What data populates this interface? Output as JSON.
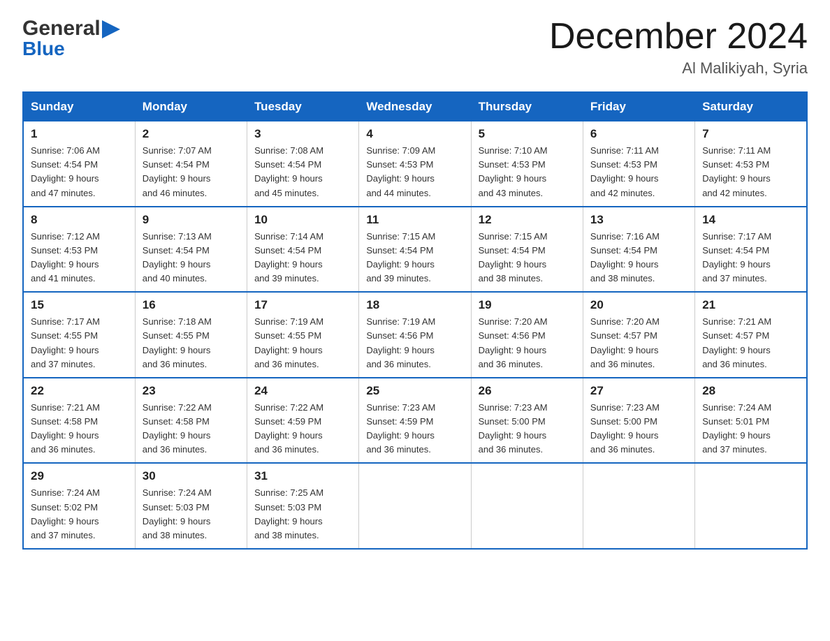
{
  "logo": {
    "line1_general": "General",
    "line2_blue": "Blue",
    "arrow": "▶"
  },
  "header": {
    "month_year": "December 2024",
    "location": "Al Malikiyah, Syria"
  },
  "weekdays": [
    "Sunday",
    "Monday",
    "Tuesday",
    "Wednesday",
    "Thursday",
    "Friday",
    "Saturday"
  ],
  "weeks": [
    [
      {
        "day": "1",
        "sunrise": "7:06 AM",
        "sunset": "4:54 PM",
        "daylight": "9 hours and 47 minutes."
      },
      {
        "day": "2",
        "sunrise": "7:07 AM",
        "sunset": "4:54 PM",
        "daylight": "9 hours and 46 minutes."
      },
      {
        "day": "3",
        "sunrise": "7:08 AM",
        "sunset": "4:54 PM",
        "daylight": "9 hours and 45 minutes."
      },
      {
        "day": "4",
        "sunrise": "7:09 AM",
        "sunset": "4:53 PM",
        "daylight": "9 hours and 44 minutes."
      },
      {
        "day": "5",
        "sunrise": "7:10 AM",
        "sunset": "4:53 PM",
        "daylight": "9 hours and 43 minutes."
      },
      {
        "day": "6",
        "sunrise": "7:11 AM",
        "sunset": "4:53 PM",
        "daylight": "9 hours and 42 minutes."
      },
      {
        "day": "7",
        "sunrise": "7:11 AM",
        "sunset": "4:53 PM",
        "daylight": "9 hours and 42 minutes."
      }
    ],
    [
      {
        "day": "8",
        "sunrise": "7:12 AM",
        "sunset": "4:53 PM",
        "daylight": "9 hours and 41 minutes."
      },
      {
        "day": "9",
        "sunrise": "7:13 AM",
        "sunset": "4:54 PM",
        "daylight": "9 hours and 40 minutes."
      },
      {
        "day": "10",
        "sunrise": "7:14 AM",
        "sunset": "4:54 PM",
        "daylight": "9 hours and 39 minutes."
      },
      {
        "day": "11",
        "sunrise": "7:15 AM",
        "sunset": "4:54 PM",
        "daylight": "9 hours and 39 minutes."
      },
      {
        "day": "12",
        "sunrise": "7:15 AM",
        "sunset": "4:54 PM",
        "daylight": "9 hours and 38 minutes."
      },
      {
        "day": "13",
        "sunrise": "7:16 AM",
        "sunset": "4:54 PM",
        "daylight": "9 hours and 38 minutes."
      },
      {
        "day": "14",
        "sunrise": "7:17 AM",
        "sunset": "4:54 PM",
        "daylight": "9 hours and 37 minutes."
      }
    ],
    [
      {
        "day": "15",
        "sunrise": "7:17 AM",
        "sunset": "4:55 PM",
        "daylight": "9 hours and 37 minutes."
      },
      {
        "day": "16",
        "sunrise": "7:18 AM",
        "sunset": "4:55 PM",
        "daylight": "9 hours and 36 minutes."
      },
      {
        "day": "17",
        "sunrise": "7:19 AM",
        "sunset": "4:55 PM",
        "daylight": "9 hours and 36 minutes."
      },
      {
        "day": "18",
        "sunrise": "7:19 AM",
        "sunset": "4:56 PM",
        "daylight": "9 hours and 36 minutes."
      },
      {
        "day": "19",
        "sunrise": "7:20 AM",
        "sunset": "4:56 PM",
        "daylight": "9 hours and 36 minutes."
      },
      {
        "day": "20",
        "sunrise": "7:20 AM",
        "sunset": "4:57 PM",
        "daylight": "9 hours and 36 minutes."
      },
      {
        "day": "21",
        "sunrise": "7:21 AM",
        "sunset": "4:57 PM",
        "daylight": "9 hours and 36 minutes."
      }
    ],
    [
      {
        "day": "22",
        "sunrise": "7:21 AM",
        "sunset": "4:58 PM",
        "daylight": "9 hours and 36 minutes."
      },
      {
        "day": "23",
        "sunrise": "7:22 AM",
        "sunset": "4:58 PM",
        "daylight": "9 hours and 36 minutes."
      },
      {
        "day": "24",
        "sunrise": "7:22 AM",
        "sunset": "4:59 PM",
        "daylight": "9 hours and 36 minutes."
      },
      {
        "day": "25",
        "sunrise": "7:23 AM",
        "sunset": "4:59 PM",
        "daylight": "9 hours and 36 minutes."
      },
      {
        "day": "26",
        "sunrise": "7:23 AM",
        "sunset": "5:00 PM",
        "daylight": "9 hours and 36 minutes."
      },
      {
        "day": "27",
        "sunrise": "7:23 AM",
        "sunset": "5:00 PM",
        "daylight": "9 hours and 36 minutes."
      },
      {
        "day": "28",
        "sunrise": "7:24 AM",
        "sunset": "5:01 PM",
        "daylight": "9 hours and 37 minutes."
      }
    ],
    [
      {
        "day": "29",
        "sunrise": "7:24 AM",
        "sunset": "5:02 PM",
        "daylight": "9 hours and 37 minutes."
      },
      {
        "day": "30",
        "sunrise": "7:24 AM",
        "sunset": "5:03 PM",
        "daylight": "9 hours and 38 minutes."
      },
      {
        "day": "31",
        "sunrise": "7:25 AM",
        "sunset": "5:03 PM",
        "daylight": "9 hours and 38 minutes."
      },
      null,
      null,
      null,
      null
    ]
  ],
  "labels": {
    "sunrise": "Sunrise:",
    "sunset": "Sunset:",
    "daylight": "Daylight:"
  }
}
